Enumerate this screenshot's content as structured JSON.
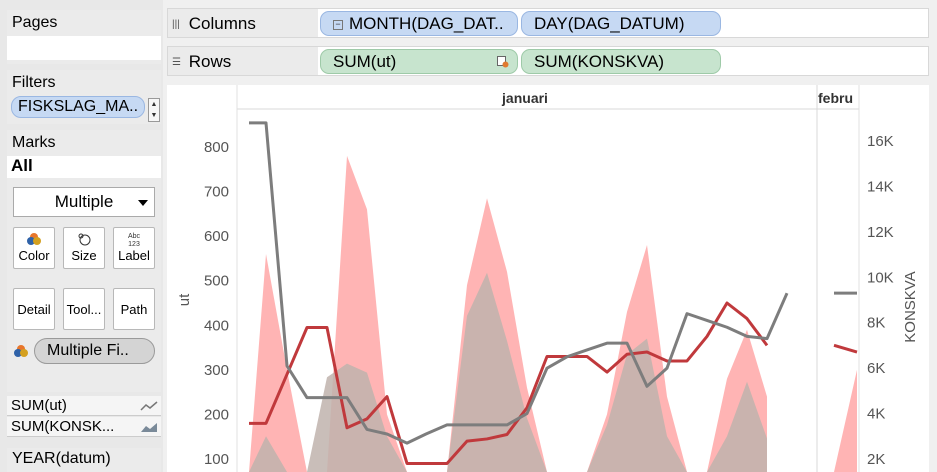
{
  "left_panel": {
    "pages": {
      "title": "Pages"
    },
    "filters": {
      "title": "Filters",
      "items": [
        {
          "label": "FISKSLAG_MA.."
        }
      ]
    },
    "marks": {
      "title": "Marks",
      "all_label": "All",
      "mark_type": "Multiple",
      "buttons": [
        {
          "label": "Color"
        },
        {
          "label": "Size"
        },
        {
          "label": "Label"
        },
        {
          "label": "Detail"
        },
        {
          "label": "Tool..."
        },
        {
          "label": "Path"
        }
      ],
      "label_icon_text": "Abc 123",
      "color_pill": "Multiple Fi..",
      "measures": [
        {
          "label": "SUM(ut)"
        },
        {
          "label": "SUM(KONSK..."
        }
      ]
    },
    "year_pill": "YEAR(datum)"
  },
  "shelves": {
    "columns": {
      "label": "Columns",
      "pills": [
        {
          "label": "MONTH(DAG_DAT.."
        },
        {
          "label": "DAY(DAG_DATUM)"
        }
      ]
    },
    "rows": {
      "label": "Rows",
      "pills": [
        {
          "label": "SUM(ut)"
        },
        {
          "label": "SUM(KONSKVA)"
        }
      ]
    }
  },
  "chart_data": {
    "type": "line",
    "panes": [
      {
        "label": "januari"
      },
      {
        "label": "februari"
      }
    ],
    "header_labels": [
      "januari",
      "febru"
    ],
    "y_left": {
      "label": "ut",
      "ticks": [
        "800",
        "700",
        "600",
        "500",
        "400",
        "300",
        "200",
        "100"
      ],
      "range": [
        0,
        870
      ]
    },
    "y_right": {
      "label": "KONSKVA",
      "ticks": [
        "16K",
        "14K",
        "12K",
        "10K",
        "8K",
        "6K",
        "4K",
        "2K"
      ],
      "range": [
        0,
        17400
      ]
    },
    "series": [
      {
        "name": "SUM(ut)",
        "type": "line",
        "color": "#c0393c",
        "x": [
          1,
          2,
          3,
          4,
          5,
          6,
          7,
          8,
          9,
          10,
          11,
          12,
          13,
          14,
          15,
          16,
          17,
          18,
          19,
          20,
          21,
          22,
          23,
          24,
          25,
          26,
          27,
          28,
          29,
          30,
          31,
          32,
          33,
          34
        ],
        "values": [
          180,
          180,
          290,
          395,
          395,
          170,
          190,
          240,
          90,
          90,
          90,
          140,
          145,
          155,
          215,
          330,
          330,
          330,
          295,
          335,
          340,
          320,
          320,
          375,
          450,
          415,
          355,
          null,
          null,
          null,
          null,
          null,
          355,
          340
        ]
      },
      {
        "name": "SUM(ut) area",
        "type": "area",
        "color": "#ffb0b0",
        "x": [
          1,
          2,
          3,
          4,
          5,
          6,
          7,
          8,
          9,
          10,
          11,
          12,
          13,
          14,
          15,
          16,
          17,
          18,
          19,
          20,
          21,
          22,
          23,
          24,
          25,
          26,
          27,
          28,
          29,
          30,
          31,
          32,
          33,
          34
        ],
        "values": [
          0,
          560,
          300,
          0,
          0,
          780,
          660,
          200,
          0,
          0,
          0,
          490,
          685,
          520,
          260,
          40,
          0,
          0,
          200,
          430,
          580,
          240,
          0,
          0,
          280,
          390,
          240,
          null,
          null,
          null,
          null,
          null,
          0,
          300
        ]
      },
      {
        "name": "SUM(KONSKVA) area",
        "type": "area",
        "color": "#bfb3ad",
        "x": [
          1,
          2,
          3,
          4,
          5,
          6,
          7,
          8,
          9,
          10,
          11,
          12,
          13,
          14,
          15,
          16,
          17,
          18,
          19,
          20,
          21,
          22,
          23,
          24,
          25,
          26,
          27,
          28,
          29,
          30,
          31,
          32,
          33,
          34
        ],
        "values": [
          0,
          3000,
          800,
          0,
          5600,
          6200,
          5800,
          3000,
          0,
          0,
          0,
          8300,
          10200,
          7200,
          3800,
          800,
          0,
          0,
          3500,
          6600,
          7300,
          3000,
          0,
          0,
          3000,
          5400,
          2900,
          null,
          null,
          null,
          null,
          null,
          0,
          600
        ]
      },
      {
        "name": "SUM(KONSKVA)",
        "type": "line",
        "color": "#7d7d7d",
        "x": [
          1,
          2,
          3,
          4,
          5,
          6,
          7,
          8,
          9,
          10,
          11,
          12,
          13,
          14,
          15,
          16,
          17,
          18,
          19,
          20,
          21,
          22,
          23,
          24,
          25,
          26,
          27,
          28,
          29,
          30,
          31,
          32,
          33,
          34
        ],
        "values": [
          16800,
          16800,
          6100,
          4700,
          4700,
          4700,
          3300,
          3100,
          2700,
          3100,
          3500,
          3500,
          3500,
          3500,
          4000,
          6000,
          6500,
          6800,
          7100,
          7100,
          5200,
          6000,
          8400,
          8100,
          7800,
          7400,
          7300,
          9300,
          null,
          null,
          null,
          null,
          9300,
          9300
        ]
      }
    ]
  }
}
